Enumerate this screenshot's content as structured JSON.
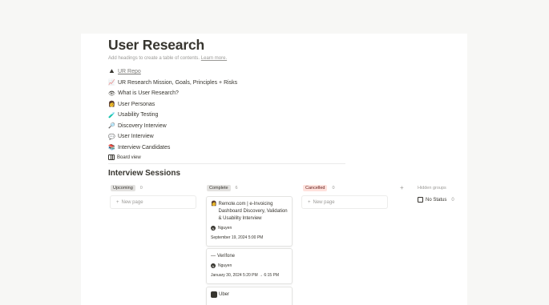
{
  "page": {
    "title": "User Research",
    "toc_hint": "Add headings to create a table of contents.",
    "toc_hint_link": "Learn more."
  },
  "links": [
    {
      "emoji": "⛰",
      "label": "UR Repo"
    },
    {
      "emoji": "📈",
      "label": "UR Research Mission, Goals, Principles + Risks"
    },
    {
      "emoji": "👁",
      "label": "What is User Research?"
    },
    {
      "emoji": "👩",
      "label": "User Personas"
    },
    {
      "emoji": "🧪",
      "label": "Usability Testing"
    },
    {
      "emoji": "🔎",
      "label": "Discovery Interview"
    },
    {
      "emoji": "💬",
      "label": "User Interview"
    },
    {
      "emoji": "📚",
      "label": "Interview Candidates"
    }
  ],
  "board_view_label": "Board view",
  "section_title": "Interview Sessions",
  "columns": [
    {
      "label": "Upcoming",
      "count": "0",
      "new_page": "New page"
    },
    {
      "label": "Complete",
      "count": "6"
    },
    {
      "label": "Cancelled",
      "count": "0",
      "new_page": "New page"
    }
  ],
  "cards": [
    {
      "title": "Remote.com | e-Invoicing Dashboard Discovery, Validation & Usability Interview",
      "person": "Nguyen",
      "date": "September 19, 2024 5:00 PM"
    },
    {
      "title": "Verifone",
      "person": "Nguyen",
      "date": "January 30, 2024 5:20 PM → 6:15 PM"
    },
    {
      "title": "Uber"
    }
  ],
  "hidden_groups_label": "Hidden groups",
  "no_status": {
    "label": "No Status",
    "count": "0"
  },
  "add_group_symbol": "+",
  "new_page_symbol": "+"
}
